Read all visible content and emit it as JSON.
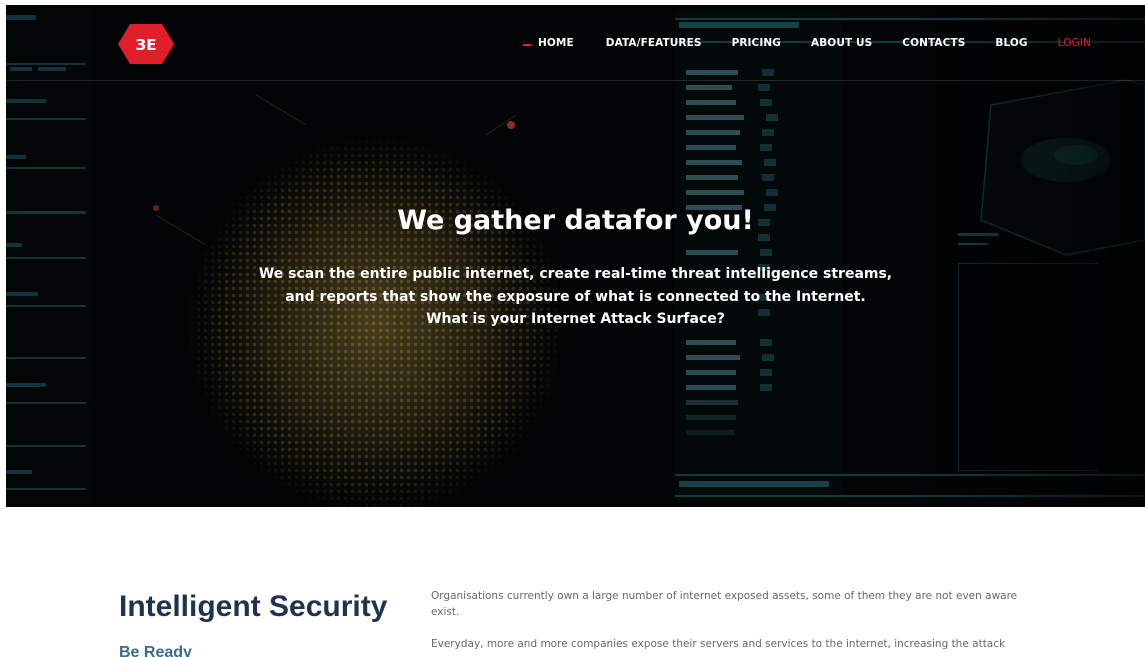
{
  "brand": {
    "logo_text": "ЗE",
    "accent_color": "#e11f2a"
  },
  "nav": {
    "items": [
      {
        "label": "HOME",
        "active": true
      },
      {
        "label": "DATA/FEATURES"
      },
      {
        "label": "PRICING"
      },
      {
        "label": "ABOUT US"
      },
      {
        "label": "CONTACTS"
      },
      {
        "label": "BLOG"
      },
      {
        "label": "LOGIN",
        "color": "#e11f2a"
      }
    ]
  },
  "hero": {
    "title": "We gather datafor you!",
    "subtitle_lines": [
      "We scan the entire public internet, create real-time threat intelligence streams,",
      "and reports that show the exposure of what is connected to the Internet.",
      "What is your Internet Attack Surface?"
    ]
  },
  "intro": {
    "title": "Intelligent Security",
    "subtitle": "Be Ready",
    "paragraphs": [
      "Organisations currently own a large number of internet exposed assets, some of them they are not even aware exist.",
      "Everyday, more and more companies expose their servers and services to the internet, increasing the attack"
    ]
  },
  "colors": {
    "title_navy": "#1f3350",
    "subtitle_blue": "#3a6b8c",
    "body_gray": "#676767"
  }
}
